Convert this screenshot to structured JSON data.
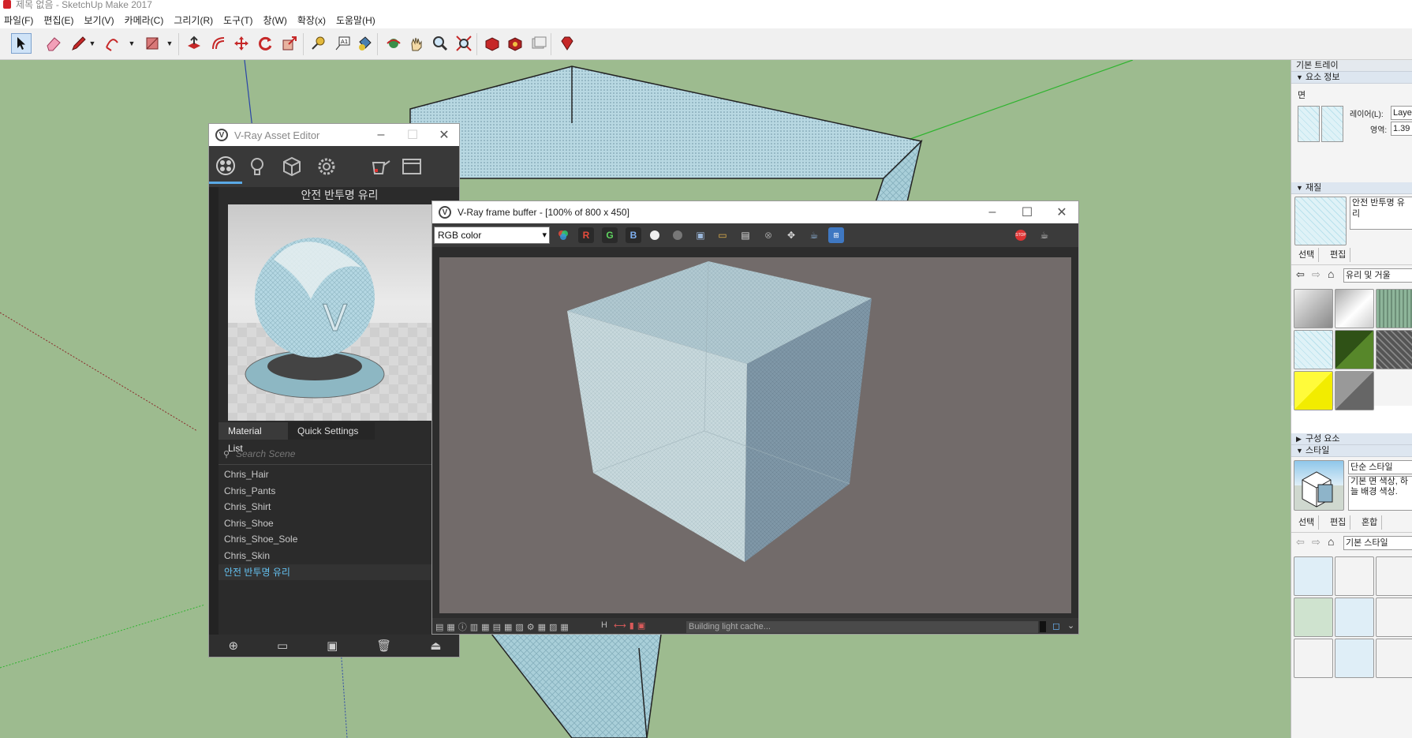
{
  "app": {
    "title": "제목 없음 - SketchUp Make 2017"
  },
  "menu": [
    "파일(F)",
    "편집(E)",
    "보기(V)",
    "카메라(C)",
    "그리기(R)",
    "도구(T)",
    "창(W)",
    "확장(x)",
    "도움말(H)"
  ],
  "toolbar": {
    "tools": [
      "select-tool",
      "eraser-tool",
      "pencil-tool",
      "arc-tool",
      "rectangle-tool",
      "push-pull-tool",
      "offset-tool",
      "move-tool",
      "rotate-tool",
      "scale-tool",
      "tape-measure-tool",
      "text-tool",
      "paint-bucket-tool",
      "orbit-tool",
      "pan-tool",
      "zoom-tool",
      "zoom-extents-tool",
      "3d-warehouse-tool",
      "extension-warehouse-tool",
      "layout-tool",
      "ruby-tool"
    ]
  },
  "tray": {
    "title": "기본 트레이",
    "entity_info": {
      "header": "요소 정보",
      "type": "면",
      "layer_label": "레이어(L):",
      "layer_value": "Laye",
      "area_label": "영역:",
      "area_value": "1.39"
    },
    "materials": {
      "header": "재질",
      "current_name": "안전 반투명 유리",
      "tab_select": "선택",
      "tab_edit": "편집",
      "collection": "유리 및 거울"
    },
    "components_header": "구성 요소",
    "styles": {
      "header": "스타일",
      "name": "단순 스타일",
      "description": "기본 면 색상, 하늘 배경 색상.",
      "tab_select": "선택",
      "tab_edit": "편집",
      "tab_mix": "혼합",
      "collection": "기본 스타일"
    }
  },
  "asset_editor": {
    "title": "V-Ray Asset Editor",
    "material_name": "안전 반투명 유리",
    "tab_list": "Material List",
    "tab_quick": "Quick Settings",
    "search_placeholder": "Search Scene",
    "materials": [
      "Chris_Hair",
      "Chris_Pants",
      "Chris_Shirt",
      "Chris_Shoe",
      "Chris_Shoe_Sole",
      "Chris_Skin",
      "안전 반투명 유리"
    ],
    "selected_index": 6
  },
  "frame_buffer": {
    "title": "V-Ray frame buffer - [100% of 800 x 450]",
    "channel": "RGB color",
    "channels": {
      "r": "R",
      "g": "G",
      "b": "B"
    },
    "status_text": "Building light cache...",
    "h_label": "H"
  },
  "colors": {
    "viewport_bg": "#9dbb8f",
    "accent_blue": "#5aa9e6",
    "selected_material": "#64c1f0"
  }
}
